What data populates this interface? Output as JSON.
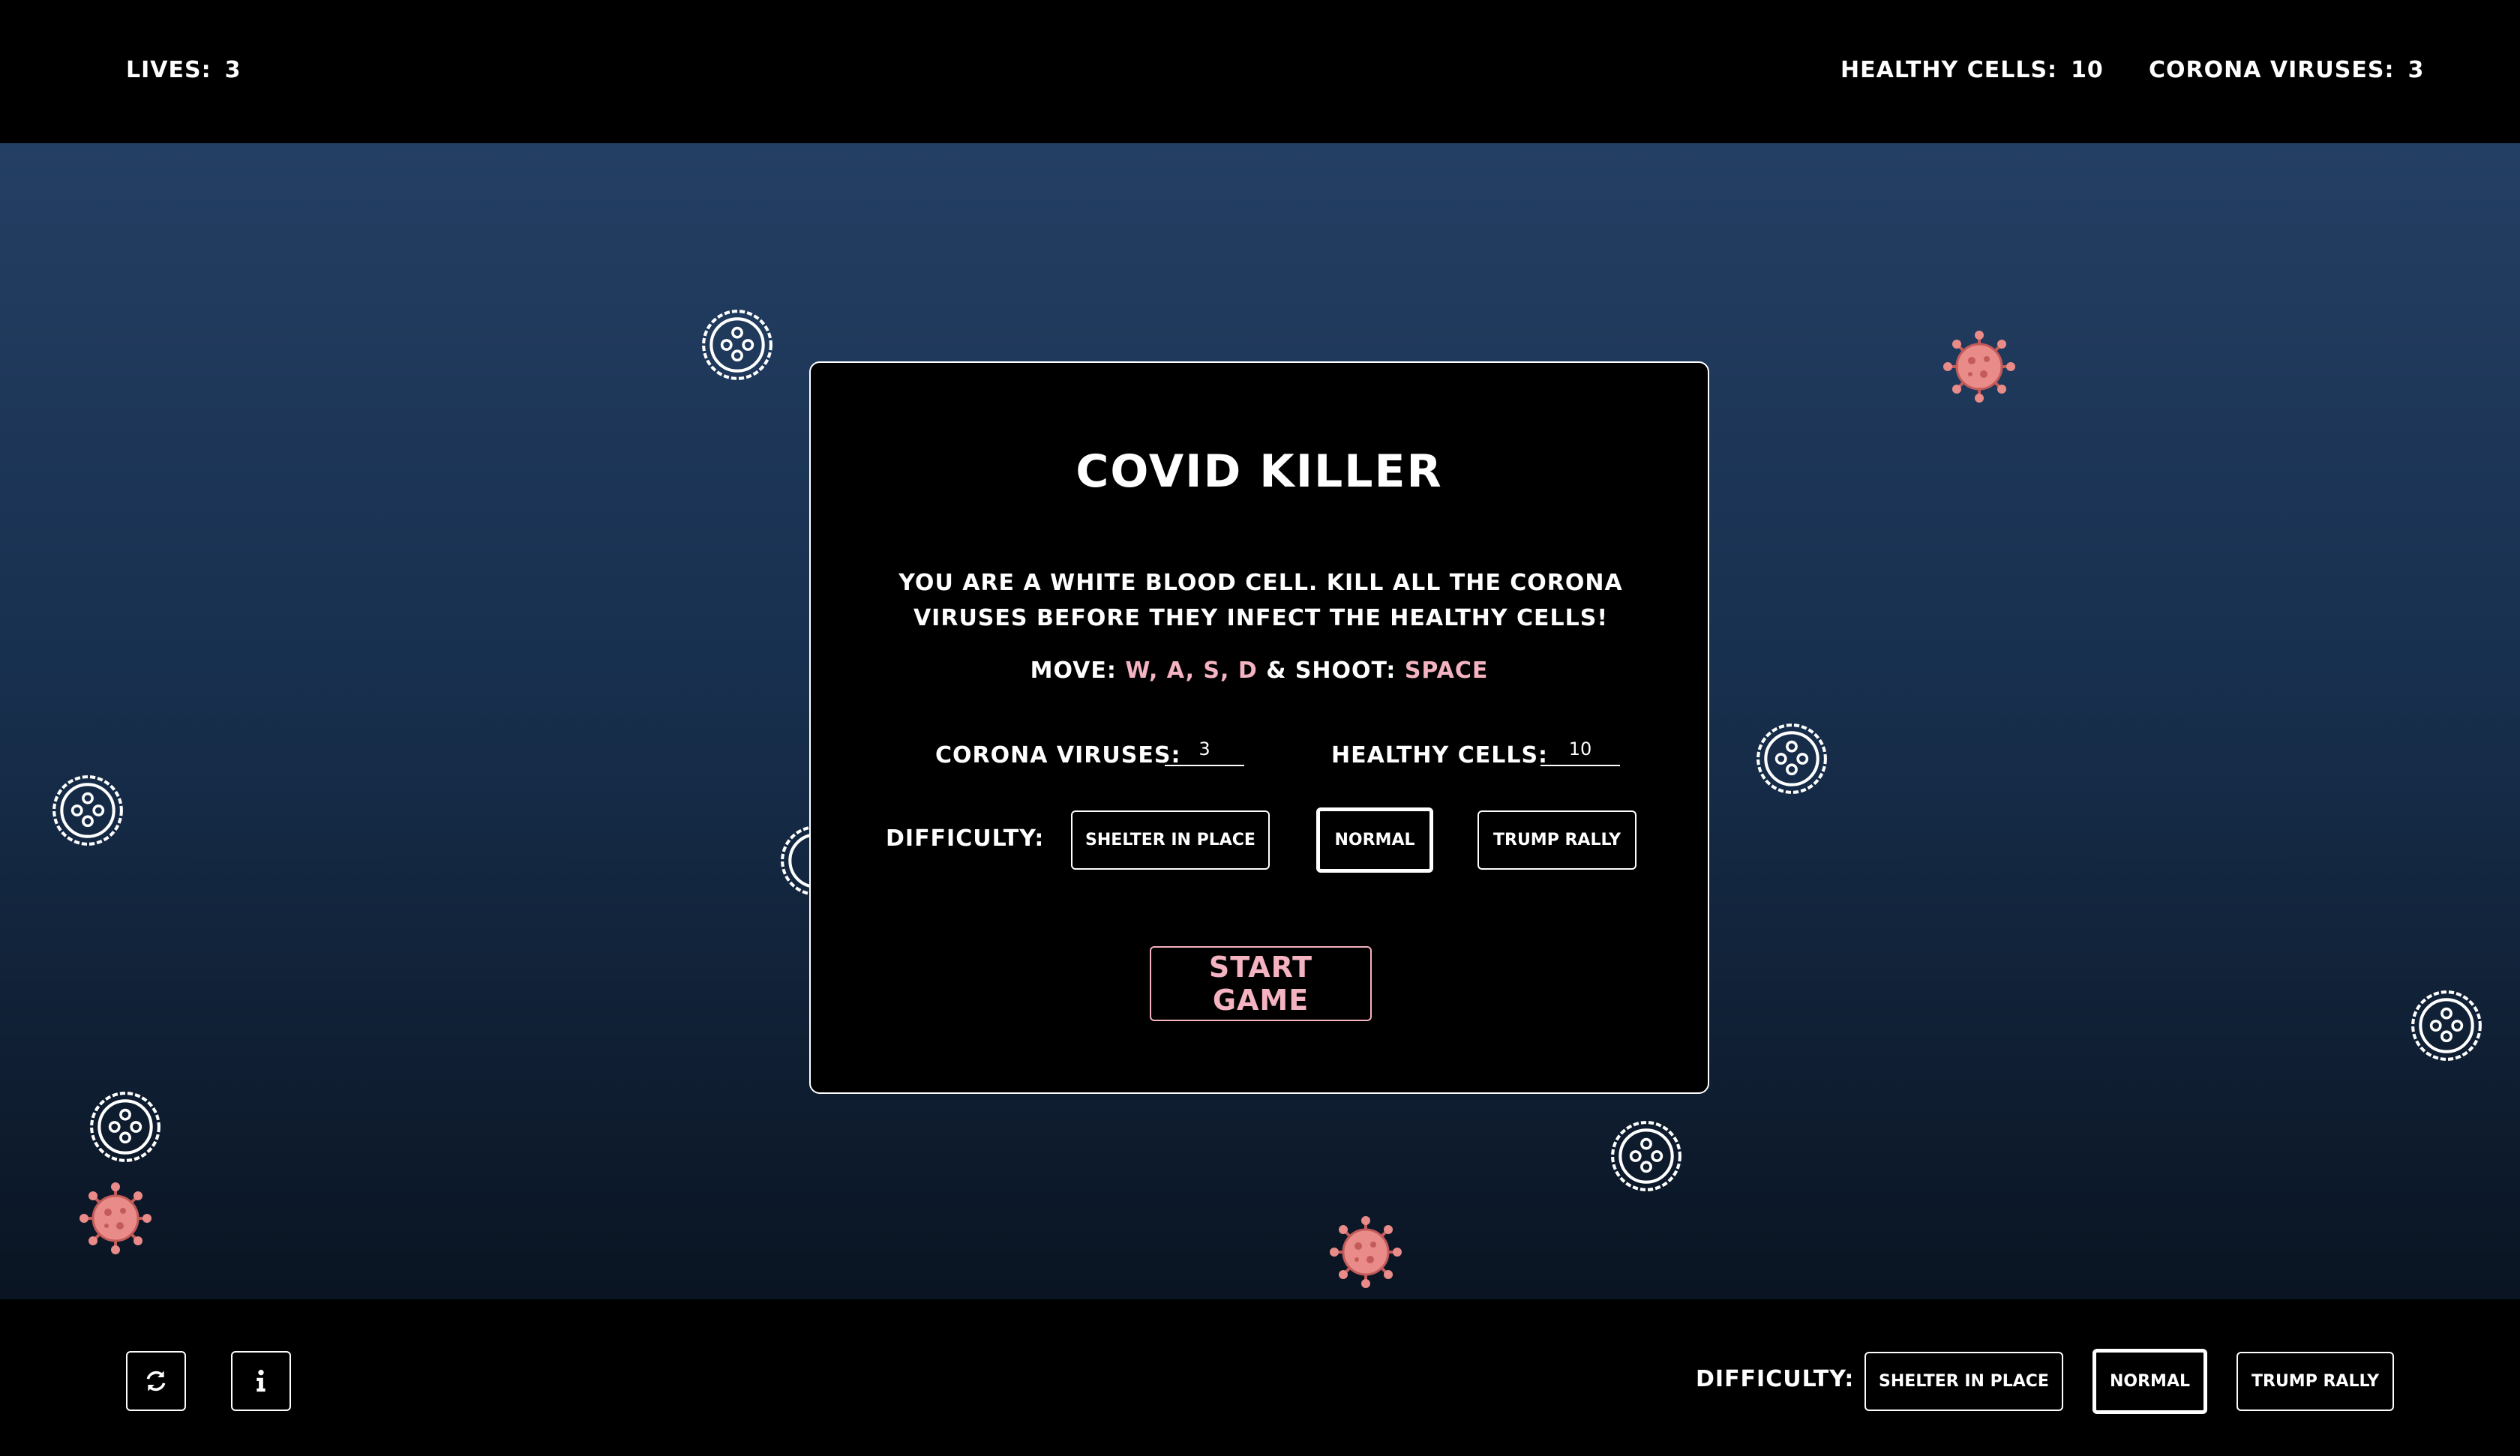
{
  "hud": {
    "lives_label": "LIVES:",
    "lives": "3",
    "healthy_label": "HEALTHY CELLS:",
    "healthy": "10",
    "viruses_label": "CORONA VIRUSES:",
    "viruses": "3"
  },
  "modal": {
    "title": "COVID KILLER",
    "description": "YOU ARE A WHITE BLOOD CELL. KILL ALL THE CORONA VIRUSES BEFORE THEY INFECT THE HEALTHY CELLS!",
    "move_prefix": "MOVE: ",
    "move_keys": "W, A, S, D",
    "shoot_prefix": " & SHOOT: ",
    "shoot_key": "SPACE",
    "viruses_label": "CORONA VIRUSES:",
    "viruses_value": "3",
    "cells_label": "HEALTHY CELLS:",
    "cells_value": "10",
    "difficulty_label": "DIFFICULTY:",
    "difficulty_options": [
      "SHELTER IN PLACE",
      "NORMAL",
      "TRUMP RALLY"
    ],
    "selected_difficulty": "NORMAL",
    "start_label": "START GAME"
  },
  "footer": {
    "difficulty_label": "DIFFICULTY:",
    "difficulty_options": [
      "SHELTER IN PLACE",
      "NORMAL",
      "TRUMP RALLY"
    ],
    "selected_difficulty": "NORMAL",
    "icons": [
      "refresh-icon",
      "info-icon"
    ]
  },
  "colors": {
    "accent_pink": "#f4b3c0",
    "virus": "#e98b88",
    "background_top": "#243f64",
    "background_bottom": "#0a1422"
  }
}
